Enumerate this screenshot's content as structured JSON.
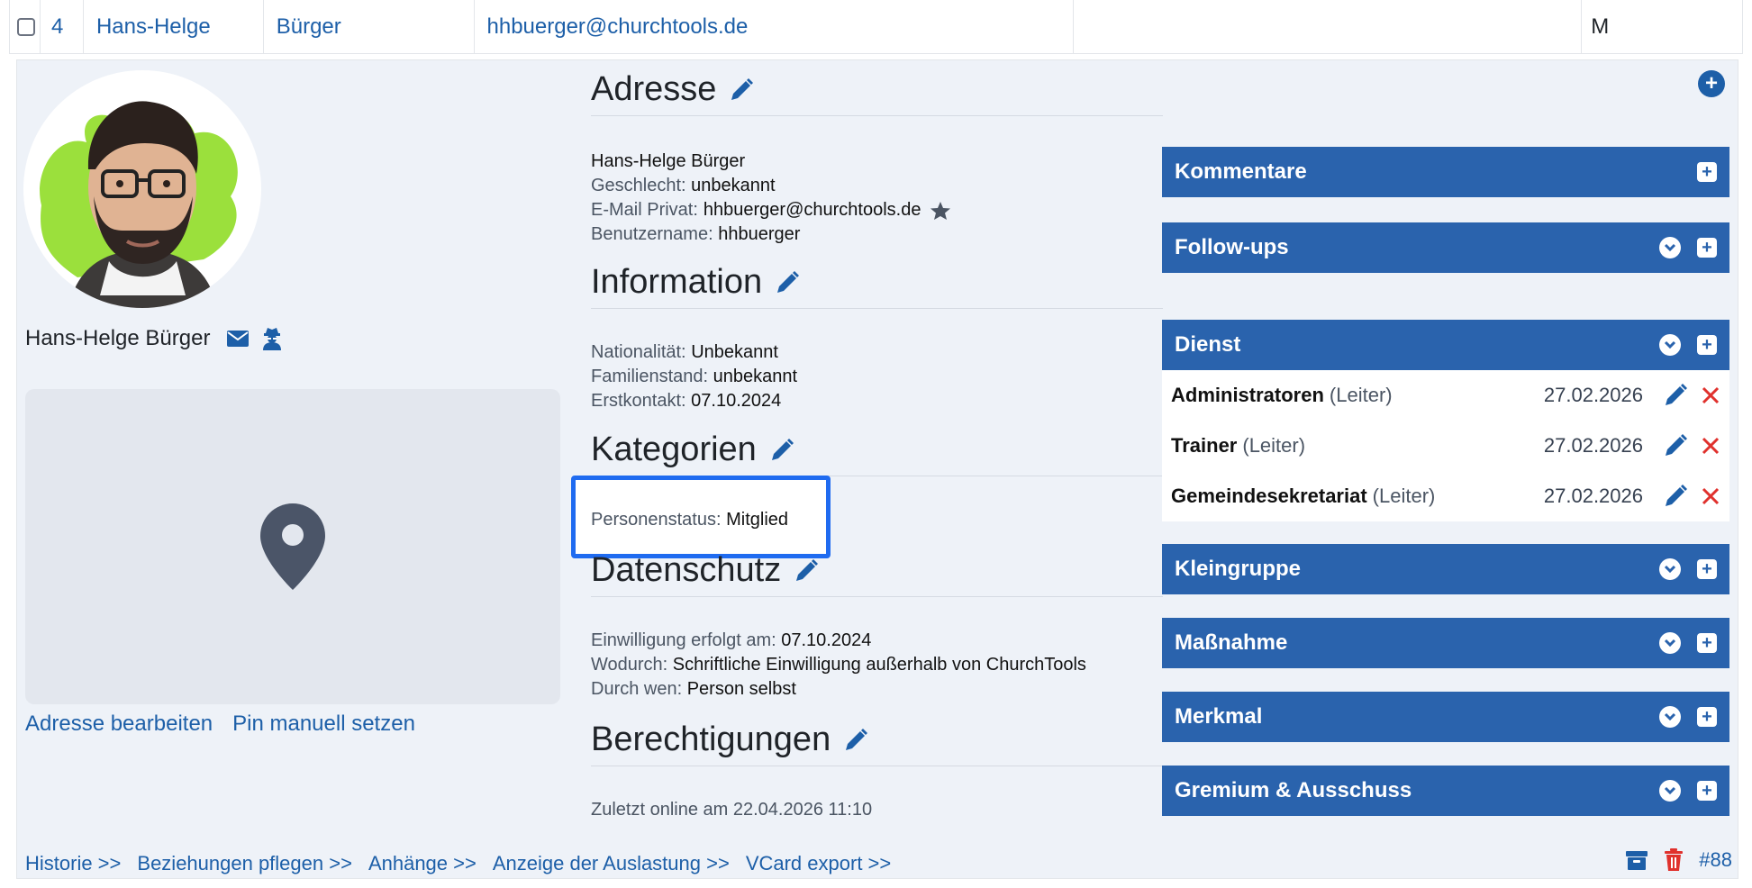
{
  "row": {
    "number": "4",
    "first_name": "Hans-Helge",
    "last_name": "Bürger",
    "email": "hhbuerger@churchtools.de",
    "empty": "",
    "gender_short": "M"
  },
  "left": {
    "name": "Hans-Helge Bürger",
    "map_links": [
      "Adresse bearbeiten",
      "Pin manuell setzen"
    ]
  },
  "sections": {
    "adresse": {
      "title": "Adresse",
      "full_name": "Hans-Helge Bürger",
      "rows": [
        {
          "key": "Geschlecht:",
          "value": "unbekannt"
        },
        {
          "key": "E-Mail Privat:",
          "value": "hhbuerger@churchtools.de"
        },
        {
          "key": "Benutzername:",
          "value": "hhbuerger"
        }
      ]
    },
    "information": {
      "title": "Information",
      "rows": [
        {
          "key": "Nationalität:",
          "value": "Unbekannt"
        },
        {
          "key": "Familienstand:",
          "value": "unbekannt"
        },
        {
          "key": "Erstkontakt:",
          "value": "07.10.2024"
        }
      ]
    },
    "kategorien": {
      "title": "Kategorien",
      "rows": [
        {
          "key": "Personenstatus:",
          "value": "Mitglied"
        }
      ]
    },
    "datenschutz": {
      "title": "Datenschutz",
      "rows": [
        {
          "key": "Einwilligung erfolgt am:",
          "value": "07.10.2024"
        },
        {
          "key": "Wodurch:",
          "value": "Schriftliche Einwilligung außerhalb von ChurchTools"
        },
        {
          "key": "Durch wen:",
          "value": "Person selbst"
        }
      ]
    },
    "berechtigungen": {
      "title": "Berechtigungen",
      "last_online": "Zuletzt online am 22.04.2026 11:10"
    }
  },
  "panels": {
    "kommentare": "Kommentare",
    "followups": "Follow-ups",
    "dienst": "Dienst",
    "kleingruppe": "Kleingruppe",
    "massnahme": "Maßnahme",
    "merkmal": "Merkmal",
    "gremium": "Gremium & Ausschuss"
  },
  "dienst_items": [
    {
      "name": "Administratoren",
      "role": "(Leiter)",
      "date": "27.02.2026"
    },
    {
      "name": "Trainer",
      "role": "(Leiter)",
      "date": "27.02.2026"
    },
    {
      "name": "Gemeindesekretariat",
      "role": "(Leiter)",
      "date": "27.02.2026"
    }
  ],
  "footer": {
    "links": [
      "Historie >>",
      "Beziehungen pflegen >>",
      "Anhänge >>",
      "Anzeige der Auslastung >>",
      "VCard export >>"
    ],
    "id": "#88"
  },
  "colors": {
    "accent": "#2a63ad",
    "link": "#1d5fa8",
    "highlight": "#1f6bf0",
    "delete": "#e0312d",
    "panel_bg": "#eef2f8"
  }
}
